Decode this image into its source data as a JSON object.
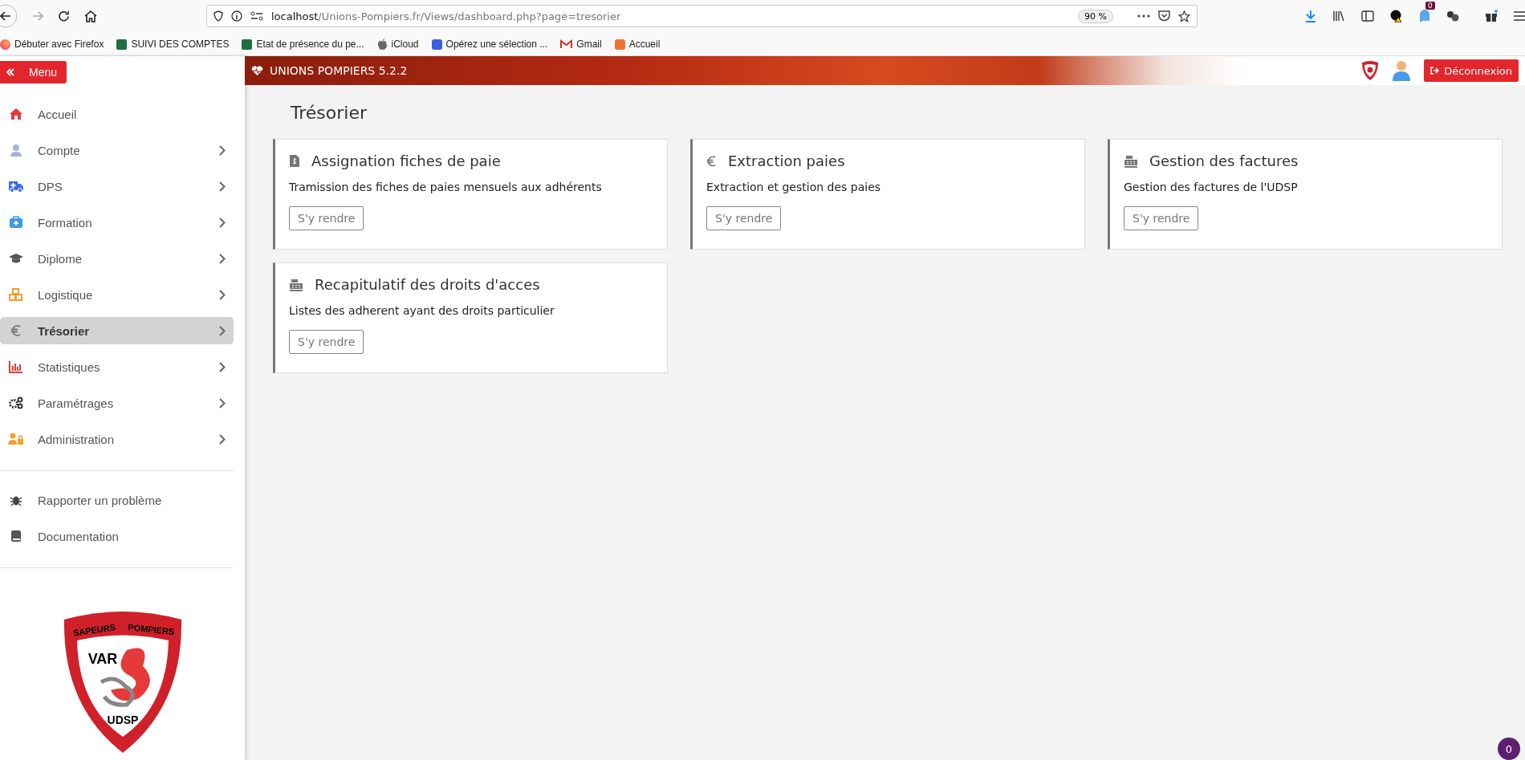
{
  "browser": {
    "url_host": "localhost",
    "url_path": "/Unions-Pompiers.fr/Views/dashboard.php?page=tresorier",
    "zoom": "90 %",
    "notification_badge": "0",
    "bookmarks": [
      "Débuter avec Firefox",
      "SUIVI DES COMPTES",
      "Etat de présence du pe...",
      "iCloud",
      "Opérez une sélection ...",
      "Gmail",
      "Accueil"
    ]
  },
  "app": {
    "menu_button": "Menu",
    "brand": "UNIONS POMPIERS 5.2.2",
    "logout": "Déconnexion"
  },
  "sidebar": {
    "items": [
      {
        "label": "Accueil",
        "selected": false,
        "has_submenu": false
      },
      {
        "label": "Compte",
        "selected": false,
        "has_submenu": true
      },
      {
        "label": "DPS",
        "selected": false,
        "has_submenu": true
      },
      {
        "label": "Formation",
        "selected": false,
        "has_submenu": true
      },
      {
        "label": "Diplome",
        "selected": false,
        "has_submenu": true
      },
      {
        "label": "Logistique",
        "selected": false,
        "has_submenu": true
      },
      {
        "label": "Trésorier",
        "selected": true,
        "has_submenu": true
      },
      {
        "label": "Statistiques",
        "selected": false,
        "has_submenu": true
      },
      {
        "label": "Paramétrages",
        "selected": false,
        "has_submenu": true
      },
      {
        "label": "Administration",
        "selected": false,
        "has_submenu": true
      }
    ],
    "secondary_items": [
      "Rapporter un problème",
      "Documentation"
    ],
    "logo": {
      "top_left": "SAPEURS",
      "top_right": "POMPIERS",
      "middle": "VAR",
      "bottom": "UDSP"
    }
  },
  "page_title": "Trésorier",
  "cards": [
    {
      "title": "Assignation fiches de paie",
      "description": "Tramission des fiches de paies mensuels aux adhérents",
      "button": "S'y rendre"
    },
    {
      "title": "Extraction paies",
      "description": "Extraction et gestion des paies",
      "button": "S'y rendre"
    },
    {
      "title": "Gestion des factures",
      "description": "Gestion des factures de l'UDSP",
      "button": "S'y rendre"
    },
    {
      "title": "Recapitulatif des droits d'acces",
      "description": "Listes des adherent ayant des droits particulier",
      "button": "S'y rendre"
    }
  ],
  "chat_badge": "0"
}
